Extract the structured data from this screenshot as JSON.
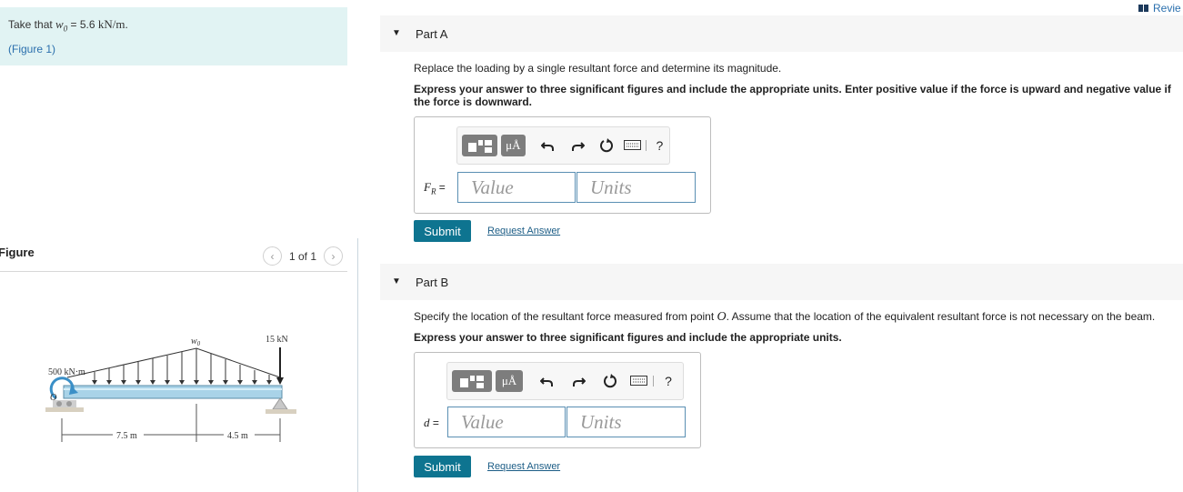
{
  "given": {
    "prefix": "Take that ",
    "symbol": "w",
    "subscript": "0",
    "equals": " = 5.6 ",
    "unit": "kN/m",
    "suffix": "."
  },
  "figure_link": "(Figure 1)",
  "figure_panel": {
    "heading": "Figure",
    "pager": "1 of 1",
    "prev_icon": "chevron-left-icon",
    "next_icon": "chevron-right-icon"
  },
  "diagram": {
    "load_label": "w",
    "load_sub": "0",
    "point_load": "15 kN",
    "moment": "500 kN·m",
    "origin": "O",
    "dim1": "7.5 m",
    "dim2": "4.5 m"
  },
  "review_link": "Revie",
  "part_a": {
    "title": "Part A",
    "prompt": "Replace the loading by a single resultant force and determine its magnitude.",
    "instruction": "Express your answer to three significant figures and include the appropriate units. Enter positive value if the force is upward and negative value if the force is downward.",
    "field_label": "F",
    "field_sub": "R",
    "equals": " =",
    "value_placeholder": "Value",
    "units_placeholder": "Units",
    "submit": "Submit",
    "request": "Request Answer"
  },
  "part_b": {
    "title": "Part B",
    "prompt_pre": "Specify the location of the resultant force measured from point ",
    "prompt_sym": "O",
    "prompt_post": ". Assume that the location of the equivalent resultant force is not necessary on the beam.",
    "instruction": "Express your answer to three significant figures and include the appropriate units.",
    "field_label": "d",
    "equals": " =",
    "value_placeholder": "Value",
    "units_placeholder": "Units",
    "submit": "Submit",
    "request": "Request Answer"
  },
  "toolbar": {
    "mu_label": "μÅ",
    "help": "?",
    "icons": [
      "templates-icon",
      "units-icon",
      "undo-icon",
      "redo-icon",
      "reset-icon",
      "keyboard-icon",
      "help-icon"
    ]
  }
}
